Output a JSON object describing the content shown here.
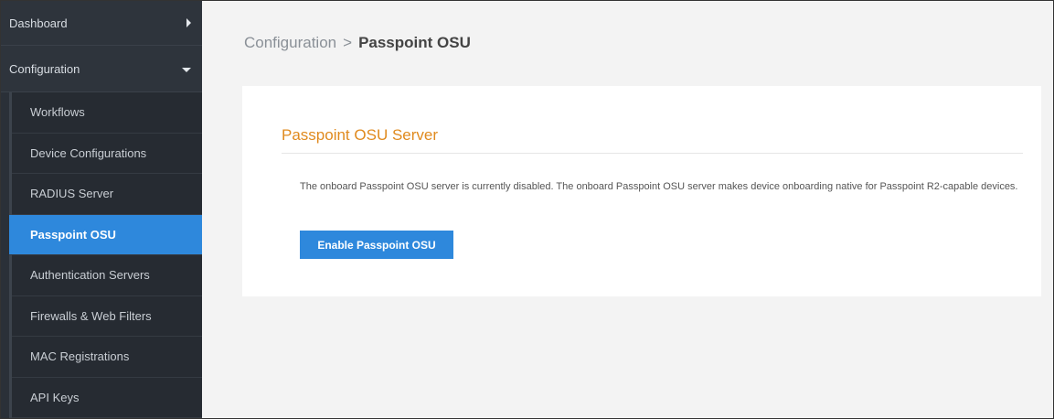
{
  "sidebar": {
    "dashboard": {
      "label": "Dashboard",
      "icon": "chevron-right-icon"
    },
    "configuration": {
      "label": "Configuration",
      "icon": "chevron-down-icon"
    },
    "items": [
      {
        "label": "Workflows"
      },
      {
        "label": "Device Configurations"
      },
      {
        "label": "RADIUS Server"
      },
      {
        "label": "Passpoint OSU",
        "active": true
      },
      {
        "label": "Authentication Servers"
      },
      {
        "label": "Firewalls & Web Filters"
      },
      {
        "label": "MAC Registrations"
      },
      {
        "label": "API Keys"
      }
    ]
  },
  "breadcrumb": {
    "parent": "Configuration",
    "separator": ">",
    "current": "Passpoint OSU"
  },
  "card": {
    "title": "Passpoint OSU Server",
    "description": "The onboard Passpoint OSU server is currently disabled. The onboard Passpoint OSU server makes device onboarding native for Passpoint R2-capable devices.",
    "button_label": "Enable Passpoint OSU"
  },
  "colors": {
    "sidebar_bg": "#2a3038",
    "accent": "#2e88dc",
    "title_orange": "#e08a1e"
  }
}
